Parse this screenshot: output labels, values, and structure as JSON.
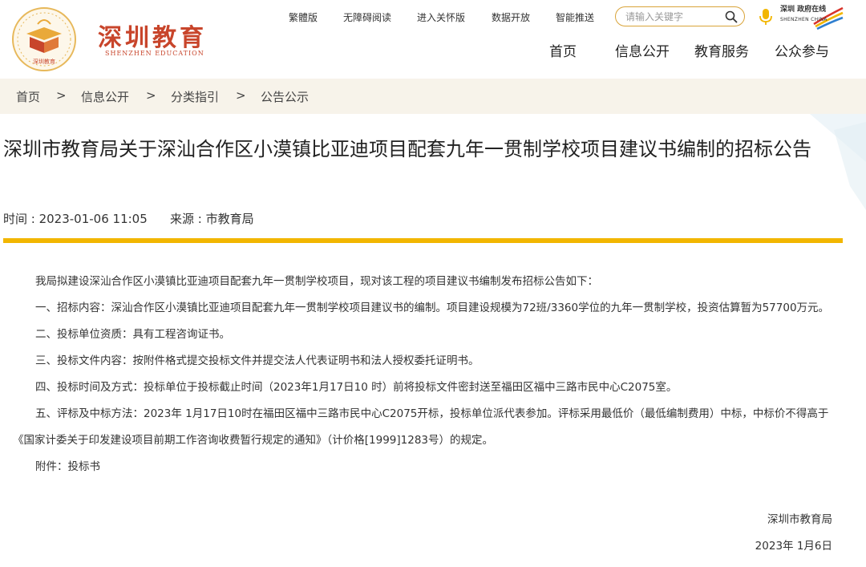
{
  "header": {
    "logo_cn": "深圳教育",
    "logo_en": "SHENZHEN EDUCATION",
    "emblem_text": "深圳教育",
    "top_links": [
      "繁體版",
      "无障碍阅读",
      "进入关怀版",
      "数据开放",
      "智能推送"
    ],
    "search": {
      "placeholder": "请输入关键字"
    },
    "brand_cn": "深圳 政府在线",
    "brand_en": "SHENZHEN CHINA",
    "nav": [
      "首页",
      "信息公开",
      "教育服务",
      "公众参与"
    ]
  },
  "breadcrumb": {
    "items": [
      "首页",
      "信息公开",
      "分类指引",
      "公告公示"
    ],
    "separator": ">"
  },
  "article": {
    "title": "深圳市教育局关于深汕合作区小漠镇比亚迪项目配套九年一贯制学校项目建议书编制的招标公告",
    "time_label": "时间 : 2023-01-06 11:05",
    "source_label": "来源 : 市教育局",
    "paragraphs": [
      "我局拟建设深汕合作区小漠镇比亚迪项目配套九年一贯制学校项目，现对该工程的项目建议书编制发布招标公告如下：",
      "一、招标内容：深汕合作区小漠镇比亚迪项目配套九年一贯制学校项目建议书的编制。项目建设规模为72班/3360学位的九年一贯制学校，投资估算暂为57700万元。",
      "二、投标单位资质：具有工程咨询证书。",
      "三、投标文件内容：按附件格式提交投标文件并提交法人代表证明书和法人授权委托证明书。",
      "四、投标时间及方式：投标单位于投标截止时间（2023年1月17日10 时）前将投标文件密封送至福田区福中三路市民中心C2075室。",
      "五、评标及中标方法：2023年 1月17日10时在福田区福中三路市民中心C2075开标，投标单位派代表参加。评标采用最低价（最低编制费用）中标，中标价不得高于《国家计委关于印发建设项目前期工作咨询收费暂行规定的通知》（计价格[1999]1283号）的规定。",
      "附件：投标书"
    ],
    "signature": "深圳市教育局",
    "date": "2023年 1月6日"
  },
  "colors": {
    "brand_red": "#c8452b",
    "accent_gold": "#f2b600",
    "breadcrumb_bg": "#f7f3ea"
  }
}
